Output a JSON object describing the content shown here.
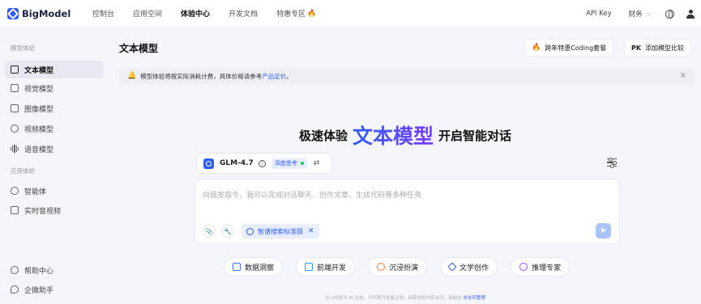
{
  "brand": {
    "name": "BigModel"
  },
  "nav": [
    {
      "label": "控制台",
      "active": false
    },
    {
      "label": "应用空间",
      "active": false
    },
    {
      "label": "体验中心",
      "active": true
    },
    {
      "label": "开发文档",
      "active": false
    },
    {
      "label": "特惠专区",
      "active": false,
      "icon": "fire-icon"
    }
  ],
  "header_right": {
    "api_key": "API Key",
    "finance": "财务"
  },
  "sidebar": {
    "section_models": "模型体验",
    "items": [
      {
        "label": "文本模型",
        "active": true,
        "icon": "text-model-icon"
      },
      {
        "label": "视觉模型",
        "active": false,
        "icon": "vision-model-icon"
      },
      {
        "label": "图像模型",
        "active": false,
        "icon": "image-model-icon"
      },
      {
        "label": "视频模型",
        "active": false,
        "icon": "video-model-icon"
      },
      {
        "label": "语音模型",
        "active": false,
        "icon": "voice-model-icon"
      }
    ],
    "section_apps": "应用体验",
    "app_items": [
      {
        "label": "智能体",
        "icon": "agent-icon"
      },
      {
        "label": "实时音视频",
        "icon": "realtime-av-icon"
      }
    ],
    "bottom_items": [
      {
        "label": "帮助中心",
        "icon": "help-icon"
      },
      {
        "label": "企微助手",
        "icon": "wecom-icon"
      }
    ]
  },
  "main": {
    "title": "文本模型",
    "promo_button": "跨年特惠Coding套餐",
    "compare_prefix": "PK",
    "compare_button": "添加模型比较",
    "notice_text": "模型体验将按实际消耗计费，具体价格请参考",
    "notice_link": "产品定价",
    "notice_end": "。",
    "hero_prefix": "极速体验",
    "hero_highlight": "文本模型",
    "hero_suffix": "开启智能对话",
    "model_name": "GLM-4.7",
    "deep_think": "深度思考",
    "input_placeholder": "向我发指令，我可以完成对话聊天、创作文章、生成代码等多种任务",
    "search_chip": "智谱搜索标准版",
    "quick_actions": [
      {
        "label": "数据洞察",
        "color": "#3b6cff"
      },
      {
        "label": "前端开发",
        "color": "#21a0ff"
      },
      {
        "label": "沉浸扮演",
        "color": "#ff7a2e"
      },
      {
        "label": "文学创作",
        "color": "#3b55e6"
      },
      {
        "label": "推理专家",
        "color": "#a64dff"
      }
    ],
    "footer_text": "以上内容为 AI 生成，不代表开发者立场，如需去除内容水印，请前往",
    "footer_link": "去水印管理"
  }
}
